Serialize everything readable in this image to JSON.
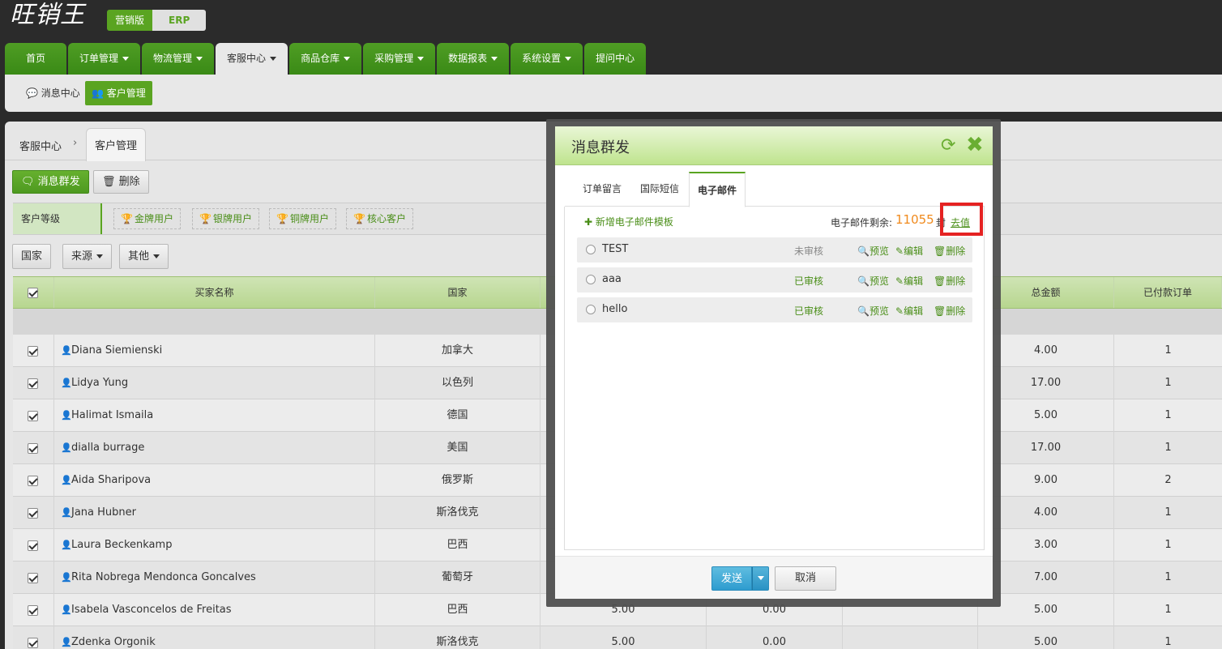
{
  "app": {
    "logo": "旺销王",
    "version_marketing": "营销版",
    "version_erp": "ERP"
  },
  "nav": {
    "items": [
      {
        "label": "首页",
        "caret": false
      },
      {
        "label": "订单管理",
        "caret": true
      },
      {
        "label": "物流管理",
        "caret": true
      },
      {
        "label": "客服中心",
        "caret": true,
        "active": true
      },
      {
        "label": "商品仓库",
        "caret": true
      },
      {
        "label": "采购管理",
        "caret": true
      },
      {
        "label": "数据报表",
        "caret": true
      },
      {
        "label": "系统设置",
        "caret": true
      },
      {
        "label": "提问中心",
        "caret": false
      }
    ]
  },
  "subnav": {
    "messages": "消息中心",
    "customers": "客户管理"
  },
  "breadcrumb": {
    "root": "客服中心",
    "separator": "›",
    "current": "客户管理"
  },
  "toolbar": {
    "broadcast": "消息群发",
    "delete": "删除"
  },
  "levels": {
    "label": "客户等级",
    "chips": [
      "金牌用户",
      "银牌用户",
      "铜牌用户",
      "核心客户"
    ]
  },
  "filters": [
    "国家",
    "来源",
    "其他"
  ],
  "table": {
    "headers": {
      "name": "买家名称",
      "country": "国家",
      "total": "总金额",
      "paid_orders": "已付款订单"
    },
    "rows": [
      {
        "name": "Diana Siemienski",
        "country": "加拿大",
        "c4": "",
        "c5": "",
        "total": "4.00",
        "paid": "1"
      },
      {
        "name": "Lidya Yung",
        "country": "以色列",
        "c4": "",
        "c5": "",
        "total": "17.00",
        "paid": "1"
      },
      {
        "name": "Halimat Ismaila",
        "country": "德国",
        "c4": "",
        "c5": "",
        "total": "5.00",
        "paid": "1"
      },
      {
        "name": "dialla burrage",
        "country": "美国",
        "c4": "",
        "c5": "",
        "total": "17.00",
        "paid": "1"
      },
      {
        "name": "Aida Sharipova",
        "country": "俄罗斯",
        "c4": "",
        "c5": "",
        "total": "9.00",
        "paid": "2"
      },
      {
        "name": "Jana Hubner",
        "country": "斯洛伐克",
        "c4": "",
        "c5": "",
        "total": "4.00",
        "paid": "1"
      },
      {
        "name": "Laura Beckenkamp",
        "country": "巴西",
        "c4": "",
        "c5": "",
        "total": "3.00",
        "paid": "1"
      },
      {
        "name": "Rita Nobrega Mendonca Goncalves",
        "country": "葡萄牙",
        "c4": "",
        "c5": "",
        "total": "7.00",
        "paid": "1"
      },
      {
        "name": "Isabela Vasconcelos de Freitas",
        "country": "巴西",
        "c4": "5.00",
        "c5": "0.00",
        "total": "5.00",
        "paid": "1"
      },
      {
        "name": "Zdenka Orgonik",
        "country": "斯洛伐克",
        "c4": "5.00",
        "c5": "0.00",
        "total": "5.00",
        "paid": "1"
      }
    ]
  },
  "modal": {
    "title": "消息群发",
    "tabs": [
      "订单留言",
      "国际短信",
      "电子邮件"
    ],
    "active_tab": "电子邮件",
    "add_template": "新增电子邮件模板",
    "quota_label": "电子邮件剩余:",
    "quota_value": "11055",
    "quota_unit": "封",
    "recharge": "去值",
    "templates": [
      {
        "name": "TEST",
        "status": "未审核",
        "status_type": "pending"
      },
      {
        "name": "aaa",
        "status": "已审核",
        "status_type": "ok"
      },
      {
        "name": "hello",
        "status": "已审核",
        "status_type": "ok"
      }
    ],
    "actions": {
      "preview": "预览",
      "edit": "编辑",
      "delete": "删除"
    },
    "send": "发送",
    "cancel": "取消"
  },
  "colors": {
    "brand_green": "#5aa421",
    "highlight_red": "#e52222",
    "quota_orange": "#f08a1d",
    "send_blue": "#2e9ccf"
  }
}
